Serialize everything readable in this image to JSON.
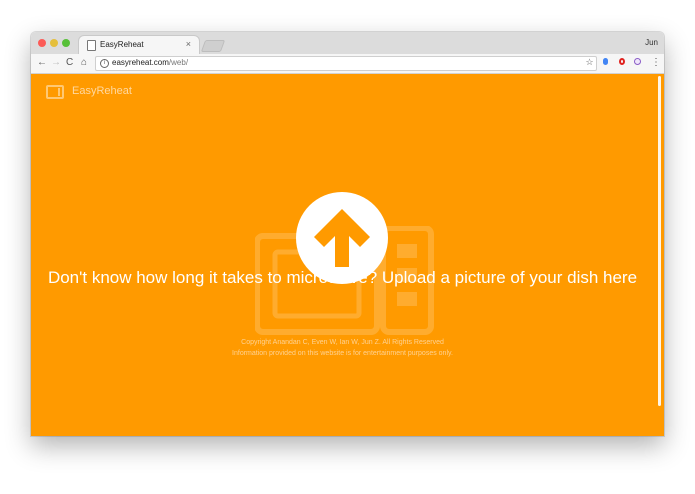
{
  "browser": {
    "tab_title": "EasyReheat",
    "tab_close": "×",
    "user_label": "Jun",
    "url_host": "easyreheat.com",
    "url_path": "/web/",
    "nav": {
      "back": "←",
      "forward": "→",
      "reload": "C",
      "home": "⌂"
    },
    "icons": {
      "star": "☆",
      "menu": "⋮",
      "info": "i"
    }
  },
  "site": {
    "logo_text": "EasyReheat",
    "headline": "Don't know how long it takes to microwave? Upload a picture of your dish here",
    "copyright_line1": "Copyright Anandan C, Even W, Ian W, Jun Z. All Rights Reserved",
    "copyright_line2": "Information provided on this website is for entertainment purposes only."
  },
  "colors": {
    "accent": "#ff9a00",
    "upload_circle": "#ffffff",
    "upload_arrow": "#ff9a00"
  }
}
